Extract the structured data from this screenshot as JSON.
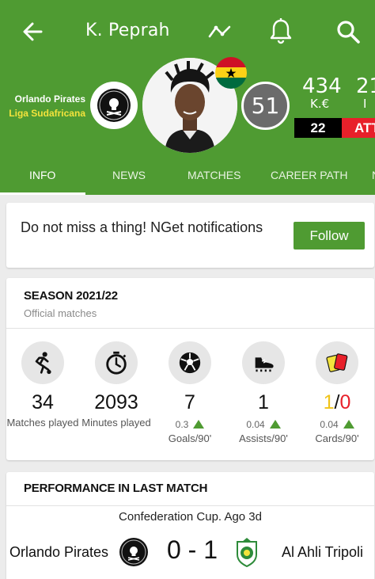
{
  "header": {
    "title": "K. Peprah",
    "club": "Orlando Pirates",
    "league": "Liga Sudafricana",
    "shirt_number": "51",
    "market_value": "434",
    "market_value_unit": "K.€",
    "second_value": "21",
    "second_value_unit": "I",
    "age": "22",
    "position": "ATT",
    "colors": {
      "green": "#4f9b32",
      "red": "#e8202a",
      "yellow": "#f3e33c"
    }
  },
  "tabs": [
    {
      "label": "INFO",
      "active": true
    },
    {
      "label": "NEWS"
    },
    {
      "label": "MATCHES"
    },
    {
      "label": "CAREER PATH"
    },
    {
      "label": "N"
    }
  ],
  "notification": {
    "text": "Do not miss a thing!  NGet notifications",
    "button": "Follow"
  },
  "season": {
    "title": "SEASON 2021/22",
    "subtitle": "Official matches",
    "stats": [
      {
        "icon": "player-running-icon",
        "value": "34",
        "label": "Matches played"
      },
      {
        "icon": "stopwatch-icon",
        "value": "2093",
        "label": "Minutes played"
      },
      {
        "icon": "soccer-ball-icon",
        "value": "7",
        "rate": "0.3",
        "rate_label": "Goals/90'"
      },
      {
        "icon": "football-boot-icon",
        "value": "1",
        "rate": "0.04",
        "rate_label": "Assists/90'"
      },
      {
        "icon": "cards-icon",
        "value_yellow": "1",
        "value_sep": "/",
        "value_red": "0",
        "rate": "0.04",
        "rate_label": "Cards/90'"
      }
    ]
  },
  "last_match": {
    "title": "PERFORMANCE IN LAST MATCH",
    "competition": "Confederation Cup. Ago 3d",
    "home": "Orlando Pirates",
    "score": "0 - 1",
    "away": "Al Ahli Tripoli"
  }
}
